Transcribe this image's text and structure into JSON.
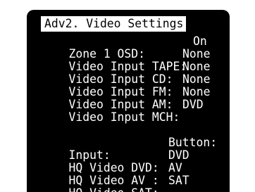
{
  "menu": {
    "title": "Adv2. Video Settings",
    "zone_osd": {
      "label": "Zone 1 OSD:",
      "value": "On"
    },
    "video_inputs": [
      {
        "label": "Video Input TAPE:",
        "value": "None"
      },
      {
        "label": "Video Input CD:",
        "value": "None"
      },
      {
        "label": "Video Input FM:",
        "value": "None"
      },
      {
        "label": "Video Input AM:",
        "value": "None"
      },
      {
        "label": "Video Input MCH:",
        "value": "DVD"
      }
    ],
    "hq_header": {
      "input": "Input:",
      "button": "Button:"
    },
    "hq_rows": [
      {
        "label": "HQ Video DVD:",
        "value": "DVD"
      },
      {
        "label": "HQ Video AV :",
        "value": "AV"
      },
      {
        "label": "HQ Video SAT:",
        "value": "SAT"
      }
    ]
  }
}
